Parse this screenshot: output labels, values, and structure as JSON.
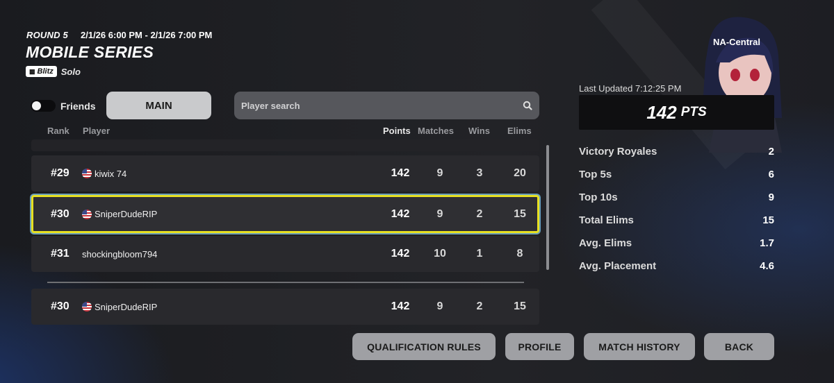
{
  "header": {
    "round": "ROUND 5",
    "dates": "2/1/26 6:00 PM - 2/1/26 7:00 PM",
    "title": "MOBILE SERIES",
    "mode_badge": "Blitz",
    "mode_text": "Solo"
  },
  "controls": {
    "friends_label": "Friends",
    "main_tab": "MAIN",
    "search_placeholder": "Player search"
  },
  "table": {
    "headers": {
      "rank": "Rank",
      "player": "Player",
      "points": "Points",
      "matches": "Matches",
      "wins": "Wins",
      "elims": "Elims"
    },
    "rows": [
      {
        "rank": "#29",
        "player": "kiwix 74",
        "points": "142",
        "matches": "9",
        "wins": "3",
        "elims": "20"
      },
      {
        "rank": "#30",
        "player": "SniperDudeRIP",
        "points": "142",
        "matches": "9",
        "wins": "2",
        "elims": "15"
      },
      {
        "rank": "#31",
        "player": "shockingbloom794",
        "points": "142",
        "matches": "10",
        "wins": "1",
        "elims": "8"
      }
    ],
    "own_row": {
      "rank": "#30",
      "player": "SniperDudeRIP",
      "points": "142",
      "matches": "9",
      "wins": "2",
      "elims": "15"
    }
  },
  "buttons": {
    "qualification_rules": "QUALIFICATION RULES",
    "profile": "PROFILE",
    "match_history": "MATCH HISTORY",
    "back": "BACK"
  },
  "panel": {
    "region": "NA-Central",
    "last_updated": "Last Updated 7:12:25 PM",
    "points": "142",
    "points_unit": "PTS",
    "stats": [
      {
        "label": "Victory Royales",
        "value": "2"
      },
      {
        "label": "Top 5s",
        "value": "6"
      },
      {
        "label": "Top 10s",
        "value": "9"
      },
      {
        "label": "Total Elims",
        "value": "15"
      },
      {
        "label": "Avg. Elims",
        "value": "1.7"
      },
      {
        "label": "Avg. Placement",
        "value": "4.6"
      }
    ]
  },
  "colors": {
    "highlight": "#e7e021",
    "accent_blue": "#2a4a9a"
  }
}
